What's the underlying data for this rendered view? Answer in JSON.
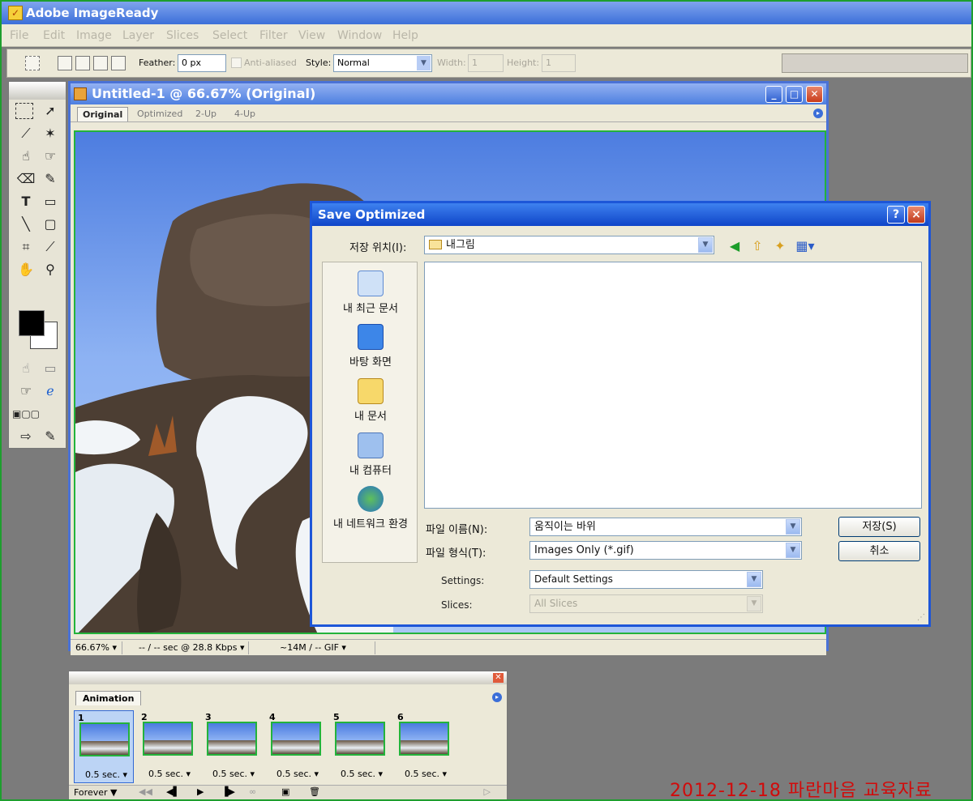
{
  "app": {
    "title": "Adobe ImageReady"
  },
  "menu": [
    "File",
    "Edit",
    "Image",
    "Layer",
    "Slices",
    "Select",
    "Filter",
    "View",
    "Window",
    "Help"
  ],
  "options": {
    "feather_label": "Feather:",
    "feather_value": "0 px",
    "anti_aliased": "Anti-aliased",
    "style_label": "Style:",
    "style_value": "Normal",
    "width_label": "Width:",
    "width_value": "1",
    "height_label": "Height:",
    "height_value": "1"
  },
  "document": {
    "title": "Untitled-1 @ 66.67% (Original)",
    "tabs": [
      "Original",
      "Optimized",
      "2-Up",
      "4-Up"
    ],
    "status_zoom": "66.67%",
    "status_speed": "-- / -- sec @ 28.8 Kbps",
    "status_size": "~14M / -- GIF"
  },
  "dialog": {
    "title": "Save Optimized",
    "help_btn": "?",
    "close_btn": "×",
    "save_in_label": "저장 위치(I):",
    "save_in_value": "내그림",
    "places": [
      "내 최근 문서",
      "바탕 화면",
      "내 문서",
      "내 컴퓨터",
      "내 네트워크 환경"
    ],
    "filename_label": "파일 이름(N):",
    "filename_value": "움직이는 바위",
    "filetype_label": "파일 형식(T):",
    "filetype_value": "Images Only (*.gif)",
    "save_btn": "저장(S)",
    "cancel_btn": "취소",
    "settings_label": "Settings:",
    "settings_value": "Default Settings",
    "slices_label": "Slices:",
    "slices_value": "All Slices"
  },
  "animation": {
    "tab": "Animation",
    "frames": [
      {
        "num": "1",
        "delay": "0.5 sec."
      },
      {
        "num": "2",
        "delay": "0.5 sec."
      },
      {
        "num": "3",
        "delay": "0.5 sec."
      },
      {
        "num": "4",
        "delay": "0.5 sec."
      },
      {
        "num": "5",
        "delay": "0.5 sec."
      },
      {
        "num": "6",
        "delay": "0.5 sec."
      }
    ],
    "loop": "Forever"
  },
  "watermark": "2012-12-18 파란마음 교육자료",
  "colors": {
    "accent": "#1d56d8",
    "watermark": "#d10b0b"
  }
}
